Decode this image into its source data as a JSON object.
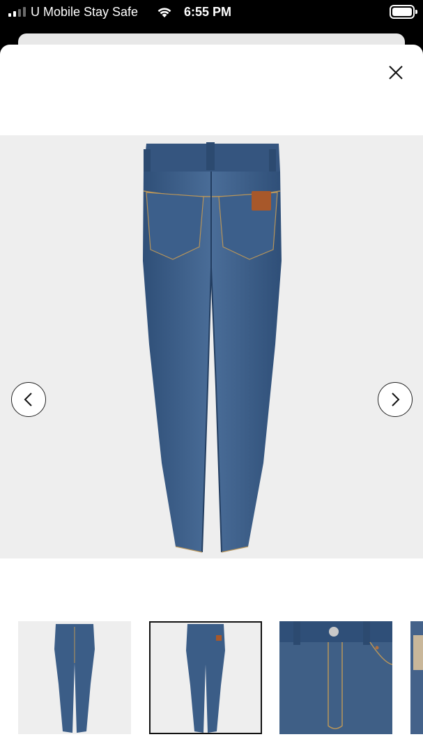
{
  "status_bar": {
    "carrier": "U Mobile Stay Safe",
    "time": "6:55 PM",
    "icons": [
      "signal-icon",
      "wifi-icon",
      "battery-icon"
    ]
  },
  "viewer": {
    "close_icon": "close-icon",
    "prev_icon": "chevron-left-icon",
    "next_icon": "chevron-right-icon",
    "main_image": "jeans-back-view",
    "thumbnails": [
      {
        "image": "jeans-front-view",
        "selected": false
      },
      {
        "image": "jeans-back-view",
        "selected": true
      },
      {
        "image": "jeans-waist-closeup",
        "selected": false
      },
      {
        "image": "jeans-label-closeup",
        "selected": false
      }
    ]
  },
  "colors": {
    "denim": "#3b5d87",
    "denim_dark": "#2a4668",
    "image_background": "#eeeeee",
    "leather_patch": "#a8582a"
  }
}
